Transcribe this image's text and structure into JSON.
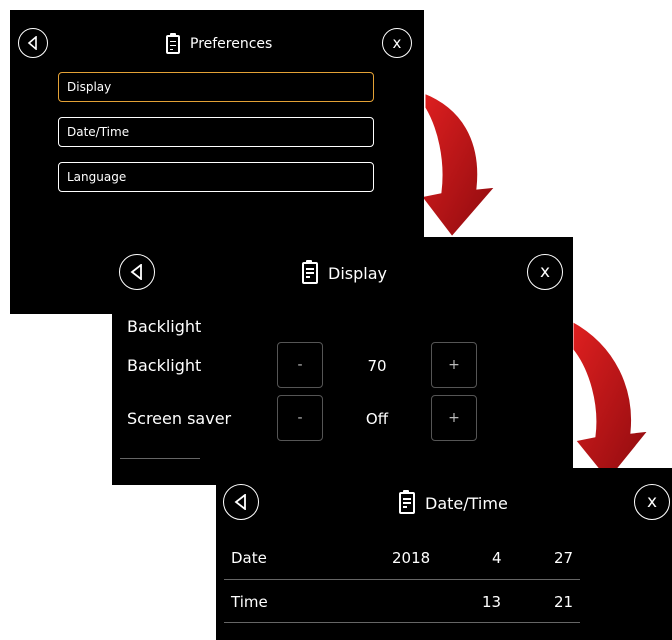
{
  "preferences": {
    "title": "Preferences",
    "close_label": "x",
    "items": [
      {
        "label": "Display",
        "selected": true
      },
      {
        "label": "Date/Time",
        "selected": false
      },
      {
        "label": "Language",
        "selected": false
      }
    ]
  },
  "display": {
    "title": "Display",
    "close_label": "x",
    "section_label": "Backlight",
    "rows": [
      {
        "label": "Backlight",
        "minus": "-",
        "value": "70",
        "plus": "+"
      },
      {
        "label": "Screen saver",
        "minus": "-",
        "value": "Off",
        "plus": "+"
      }
    ]
  },
  "datetime": {
    "title": "Date/Time",
    "close_label": "x",
    "date": {
      "label": "Date",
      "year": "2018",
      "month": "4",
      "day": "27"
    },
    "time": {
      "label": "Time",
      "hour": "13",
      "minute": "21"
    }
  },
  "colors": {
    "panel": "#000000",
    "selected_border": "#e4a236",
    "arrow": "#c0141a"
  }
}
